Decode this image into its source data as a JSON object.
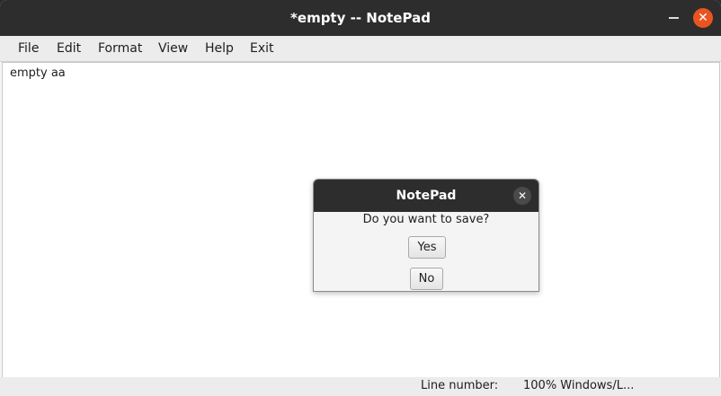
{
  "window": {
    "title": "*empty -- NotePad",
    "icons": {
      "minimize": "minimize-icon",
      "close": "close-icon"
    }
  },
  "menu": {
    "items": [
      "File",
      "Edit",
      "Format",
      "View",
      "Help",
      "Exit"
    ]
  },
  "editor": {
    "content": "empty aa"
  },
  "status": {
    "line_label": "Line number:",
    "zoom_info": "100% Windows/L..."
  },
  "dialog": {
    "title": "NotePad",
    "message": "Do you want to save?",
    "yes_label": "Yes",
    "no_label": "No",
    "close_icon": "close-icon"
  },
  "colors": {
    "titlebar": "#2d2d2d",
    "close_accent": "#e95420"
  }
}
